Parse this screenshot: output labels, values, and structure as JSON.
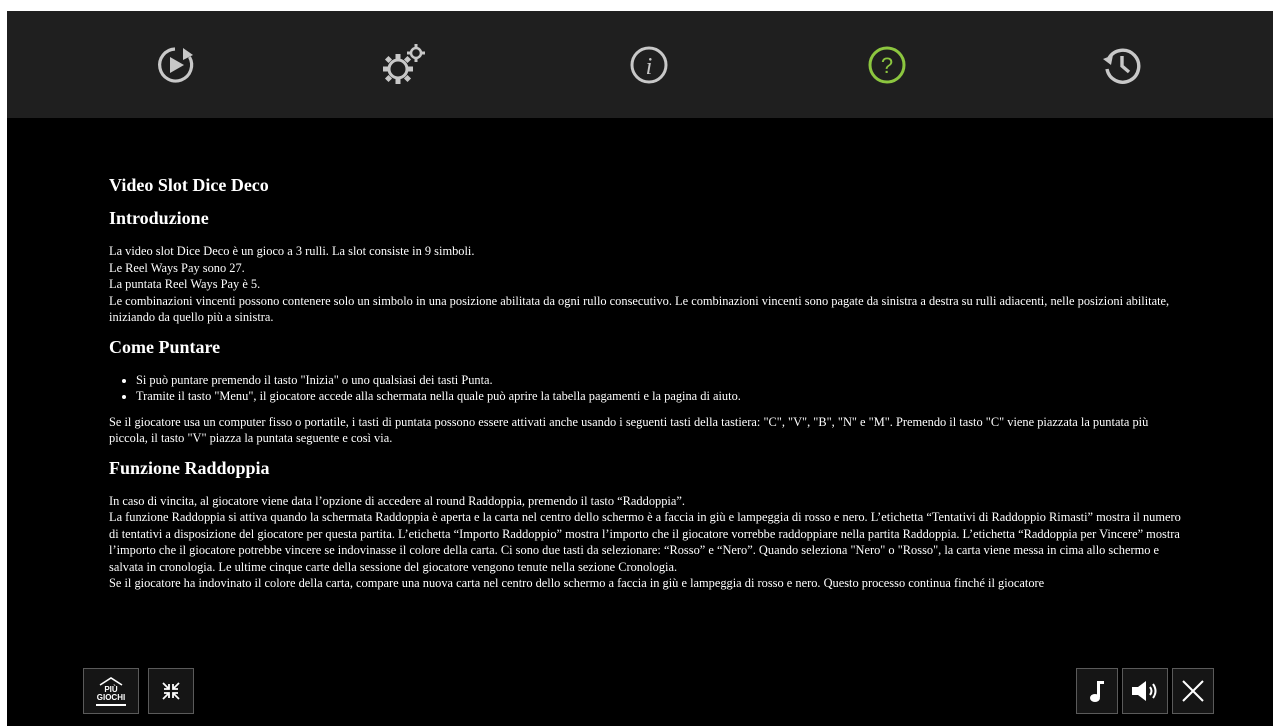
{
  "colors": {
    "accent": "#8cc63f",
    "bar": "#1f1f1f",
    "background": "#000000",
    "icon": "#c8c8c8"
  },
  "nav": {
    "items": [
      {
        "icon": "play-replay-icon"
      },
      {
        "icon": "settings-gears-icon"
      },
      {
        "icon": "info-icon"
      },
      {
        "icon": "help-question-icon",
        "active": true
      },
      {
        "icon": "history-clock-icon"
      }
    ]
  },
  "help": {
    "title": "Video Slot Dice Deco",
    "sections": {
      "intro": {
        "heading": "Introduzione",
        "lines": [
          "La video slot Dice Deco è un gioco a 3 rulli. La slot consiste in 9 simboli.",
          "Le Reel Ways Pay sono 27.",
          "La puntata Reel Ways Pay è 5.",
          "Le combinazioni vincenti possono contenere solo un simbolo in una posizione abilitata da ogni rullo consecutivo. Le combinazioni vincenti sono pagate da sinistra a destra su rulli adiacenti, nelle posizioni abilitate, iniziando da quello più a sinistra."
        ]
      },
      "betting": {
        "heading": "Come Puntare",
        "bullets": [
          "Si può puntare premendo il tasto \"Inizia\" o uno qualsiasi dei tasti Punta.",
          "Tramite il tasto \"Menu\", il giocatore accede alla schermata nella quale può aprire la tabella pagamenti e la pagina di aiuto."
        ],
        "paragraph": "Se il giocatore usa un computer fisso o portatile, i tasti di puntata possono essere attivati anche usando i seguenti tasti della tastiera: \"C\", \"V\", \"B\", \"N\" e \"M\". Premendo il tasto \"C\" viene piazzata la puntata più piccola, il tasto \"V\" piazza la puntata seguente e così via."
      },
      "double": {
        "heading": "Funzione Raddoppia",
        "lines": [
          "In caso di vincita, al giocatore viene data l’opzione di accedere al round Raddoppia, premendo il tasto “Raddoppia”.",
          "La funzione Raddoppia si attiva quando la schermata Raddoppia è aperta e la carta nel centro dello schermo è a faccia in giù e lampeggia di rosso e nero. L’etichetta “Tentativi di Raddoppio Rimasti” mostra il numero di tentativi a disposizione del giocatore per questa partita. L’etichetta “Importo Raddoppio” mostra l’importo che il giocatore vorrebbe raddoppiare nella partita Raddoppia. L’etichetta “Raddoppia per Vincere” mostra l’importo che il giocatore potrebbe vincere se indovinasse il colore della carta. Ci sono due tasti da selezionare: “Rosso” e “Nero”. Quando seleziona \"Nero\" o \"Rosso\", la carta viene messa in cima allo schermo e salvata in cronologia. Le ultime cinque carte della sessione del giocatore vengono tenute nella sezione Cronologia.",
          "Se il giocatore ha indovinato il colore della carta, compare una nuova carta nel centro dello schermo a faccia in giù e lampeggia di rosso e nero. Questo processo continua finché il giocatore"
        ]
      }
    }
  },
  "bottom": {
    "more_games_line1": "PIÙ",
    "more_games_line2": "GIOCHI",
    "minimize_icon": "minimize-arrows-icon",
    "music_icon": "music-note-icon",
    "sound_icon": "speaker-icon",
    "close_icon": "close-icon"
  }
}
